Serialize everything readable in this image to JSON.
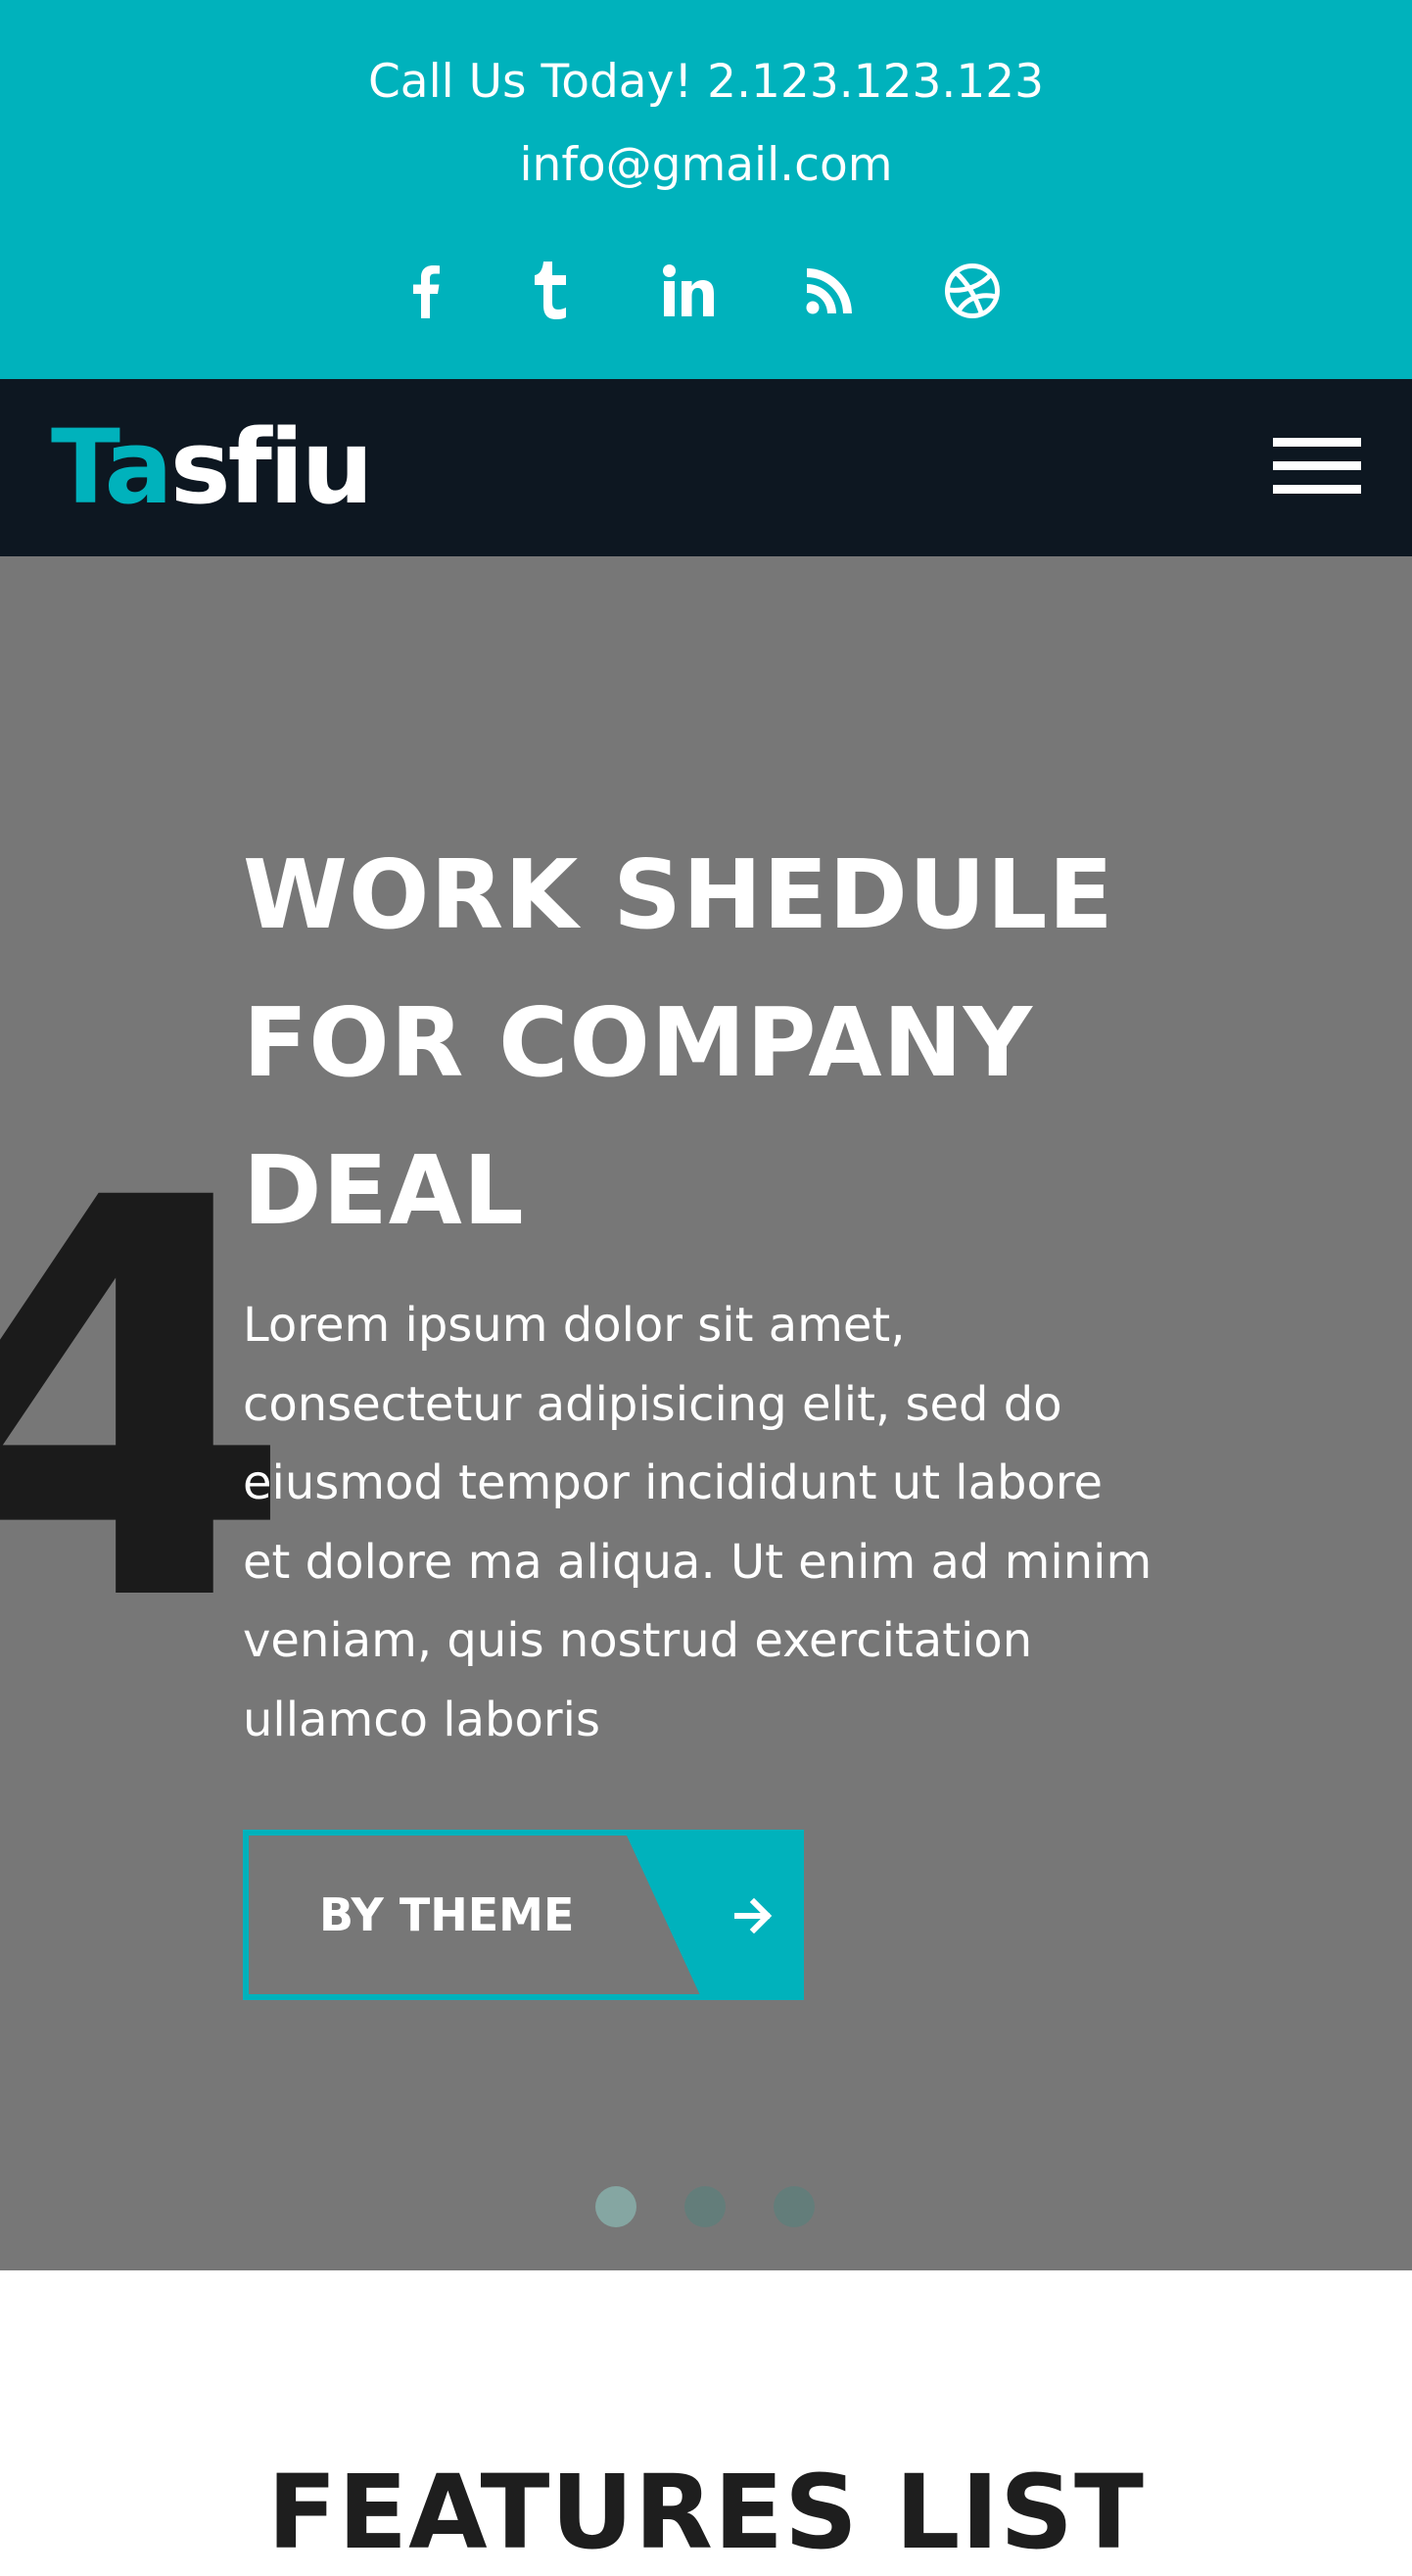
{
  "contact": {
    "phone_text": "Call Us Today! 2.123.123.123",
    "email": "info@gmail.com"
  },
  "social": [
    {
      "name": "facebook-icon"
    },
    {
      "name": "tumblr-icon"
    },
    {
      "name": "linkedin-icon"
    },
    {
      "name": "rss-icon"
    },
    {
      "name": "dribbble-icon"
    }
  ],
  "brand": {
    "logo_part1": "Ta",
    "logo_part2": "sfiu"
  },
  "nav": {
    "menu_icon": "hamburger-menu-icon"
  },
  "hero": {
    "background_number": "4",
    "title_lines": [
      "WORK SHEDULE",
      "FOR COMPANY",
      "DEAL"
    ],
    "body_lines": [
      "Lorem ipsum dolor sit amet,",
      "consectetur adipisicing elit, sed do",
      "eiusmod tempor incididunt ut labore",
      "et dolore ma aliqua. Ut enim ad minim",
      "veniam, quis nostrud exercitation",
      "ullamco laboris"
    ],
    "cta_label": "BY THEME",
    "cta_icon": "arrow-right-icon",
    "slides_count": 3,
    "active_slide": 1
  },
  "features": {
    "title": "FEATURES LIST"
  },
  "colors": {
    "accent": "#00b2bc",
    "navbar": "#0d1721",
    "hero_bg": "#777777",
    "dot_active": "#85a6a2",
    "dot_inactive": "#637d7a",
    "text_light": "#ffffff"
  }
}
